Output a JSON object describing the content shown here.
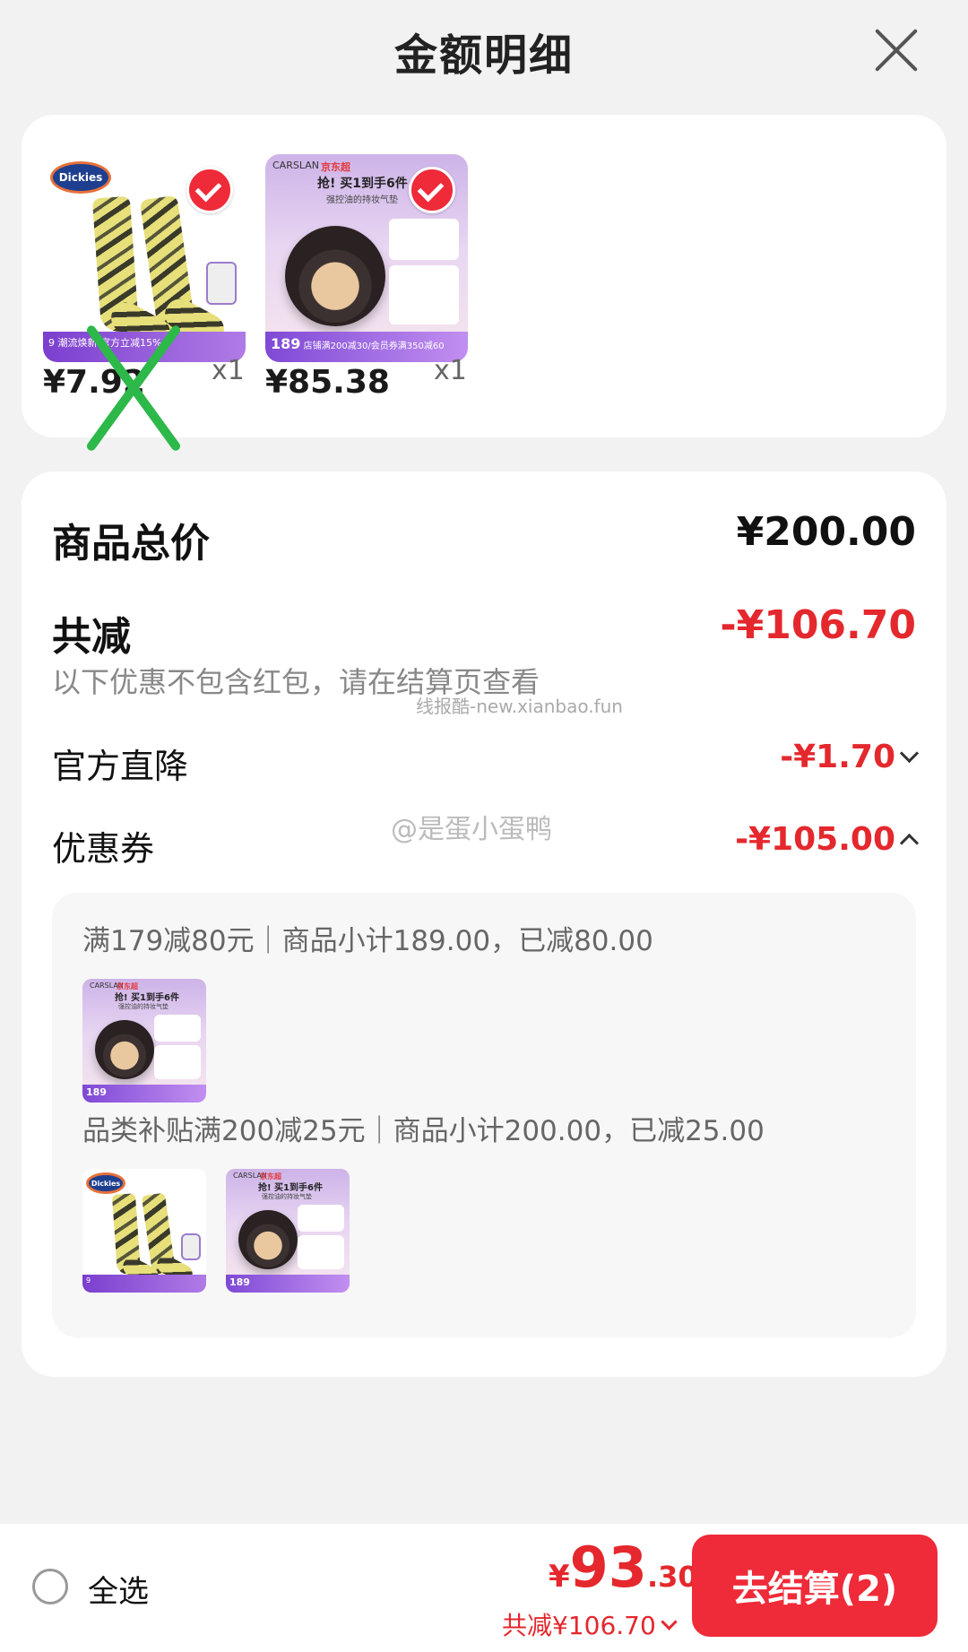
{
  "header": {
    "title": "金额明细"
  },
  "products": [
    {
      "name": "Dickies socks",
      "brand_logo": "Dickies",
      "price": "¥7.92",
      "qty": "x1",
      "promo": "潮流焕新 官方立减15%",
      "badge_num": "9"
    },
    {
      "name": "CARSLAN cushion",
      "brand_logo": "CARSLAN",
      "jd": "京东超",
      "headline": "抢! 买1到手6件",
      "sub": "强控油的持妆气垫",
      "price": "¥85.38",
      "qty": "x1",
      "promo": "店铺满200减30/会员券满350减60",
      "badge_num": "189"
    }
  ],
  "summary": {
    "total_label": "商品总价",
    "total_value": "¥200.00",
    "reduce_label": "共减",
    "reduce_value": "-¥106.70",
    "note": "以下优惠不包含红包，请在结算页查看",
    "official_label": "官方直降",
    "official_value": "-¥1.70",
    "coupon_label": "优惠券",
    "coupon_value": "-¥105.00"
  },
  "coupons": [
    {
      "text": "满179减80元｜商品小计189.00，已减80.00"
    },
    {
      "text": "品类补贴满200减25元｜商品小计200.00，已减25.00"
    }
  ],
  "watermarks": {
    "w1": "线报酷-new.xianbao.fun",
    "w2": "@是蛋小蛋鸭"
  },
  "bottom": {
    "select_all": "全选",
    "pay_yen": "¥",
    "pay_int": "93",
    "pay_dec": ".30",
    "pay_reduce": "共减¥106.70",
    "checkout_label": "去结算(2)"
  },
  "colors": {
    "accent": "#ef2a39",
    "reduce_red": "#e4282d",
    "check_mark": "#2db84a"
  }
}
